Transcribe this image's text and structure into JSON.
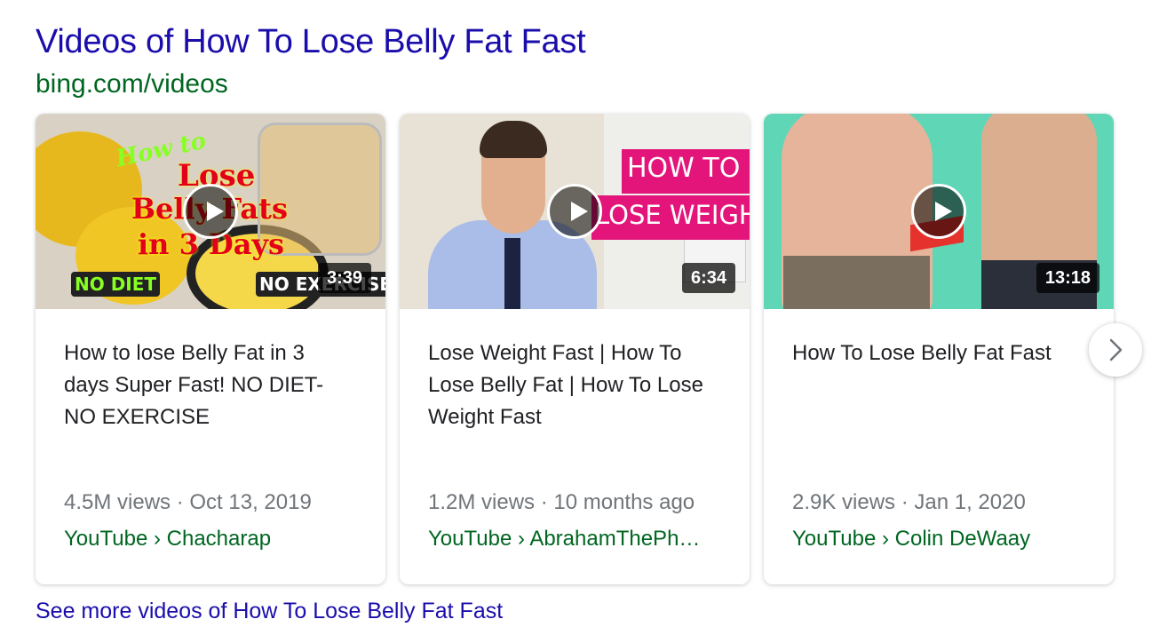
{
  "header": {
    "title": "Videos of How To Lose Belly Fat Fast",
    "source": "bing.com/videos"
  },
  "videos": [
    {
      "title": "How to lose Belly Fat in 3 days Super Fast! NO DIET- NO EXERCISE",
      "duration": "3:39",
      "meta": "4.5M views · Oct 13, 2019",
      "channel": "YouTube › Chacharap",
      "thumb_text": {
        "line1": "How to",
        "line2": "Lose",
        "line3": "Belly Fats",
        "line4": "in 3 Days",
        "badge_left": "NO DIET",
        "badge_right": "NO EXERCISE"
      }
    },
    {
      "title": "Lose Weight Fast | How To Lose Belly Fat | How To Lose Weight Fast",
      "duration": "6:34",
      "meta": "1.2M views · 10 months ago",
      "channel": "YouTube › AbrahamThePh…",
      "thumb_text": {
        "line1": "HOW TO",
        "line2": "LOSE WEIGHT"
      }
    },
    {
      "title": "How To Lose Belly Fat Fast",
      "duration": "13:18",
      "meta": "2.9K views · Jan 1, 2020",
      "channel": "YouTube › Colin DeWaay"
    }
  ],
  "footer": {
    "see_more": "See more videos of How To Lose Belly Fat Fast"
  },
  "icons": {
    "play": "play-icon",
    "next": "chevron-right-icon"
  }
}
